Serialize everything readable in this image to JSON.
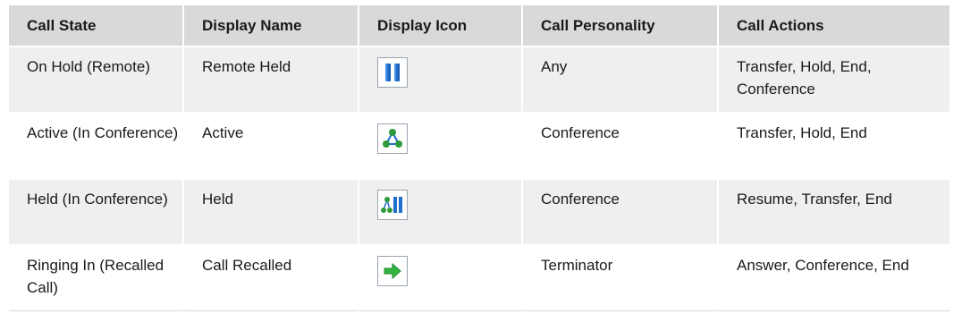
{
  "table": {
    "headers": [
      "Call State",
      "Display Name",
      "Display Icon",
      "Call Personality",
      "Call Actions"
    ],
    "rows": [
      {
        "state": "On Hold (Remote)",
        "display_name": "Remote Held",
        "icon": "remote-held-icon",
        "personality": "Any",
        "actions": "Transfer, Hold, End, Conference"
      },
      {
        "state": "Active (In Conference)",
        "display_name": "Active",
        "icon": "conference-active-icon",
        "personality": "Conference",
        "actions": "Transfer, Hold, End"
      },
      {
        "state": "Held (In Conference)",
        "display_name": "Held",
        "icon": "conference-held-icon",
        "personality": "Conference",
        "actions": "Resume, Transfer, End"
      },
      {
        "state": "Ringing In (Recalled Call)",
        "display_name": "Call Recalled",
        "icon": "call-recalled-arrow-icon",
        "personality": "Terminator",
        "actions": "Answer, Conference, End"
      }
    ]
  },
  "colors": {
    "header_bg": "#d9d9d9",
    "row_shade_bg": "#efefef",
    "hold_blue": "#1f6fd1",
    "conference_green": "#2e9a3a",
    "arrow_green": "#33b53f"
  }
}
